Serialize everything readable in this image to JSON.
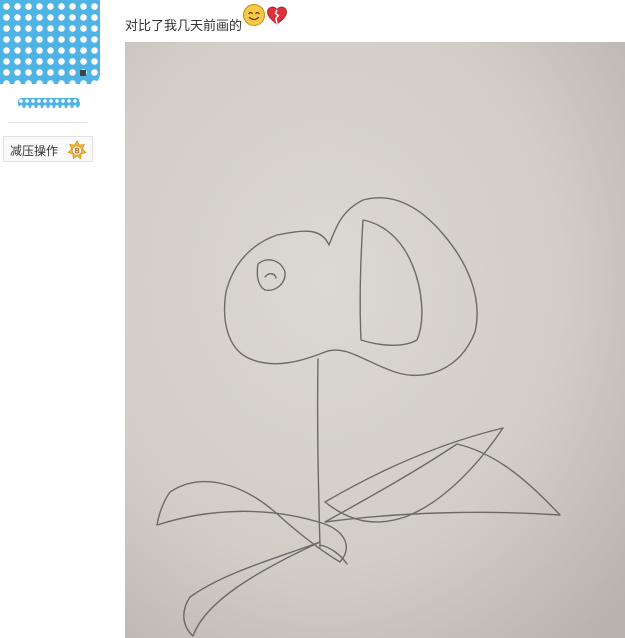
{
  "author": {
    "level_name": "减压操作",
    "level_number": "8"
  },
  "post": {
    "text": "对比了我几天前画的",
    "emojis": [
      "smile-emoji-icon",
      "broken-heart-emoji-icon"
    ]
  },
  "colors": {
    "avatar_blue": "#4fb3e6",
    "badge_gold": "#f0b43a",
    "paper": "#d4cfc8"
  }
}
